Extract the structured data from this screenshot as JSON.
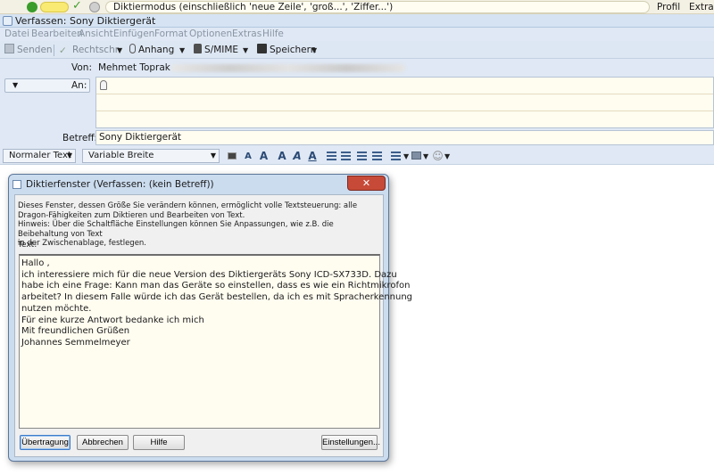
{
  "dragon_bar": {
    "status_text": "Diktiermodus (einschließlich 'neue Zeile', 'groß...', 'Ziffer...')",
    "profile_menu": "Profil",
    "extras_menu": "Extras",
    "icons": [
      "microphone-icon",
      "volume-meter-icon",
      "checkmark-icon",
      "stop-icon"
    ]
  },
  "window": {
    "title": "Verfassen: Sony Diktiergerät"
  },
  "menubar": {
    "items": [
      "Datei",
      "Bearbeiten",
      "Ansicht",
      "Einfügen",
      "Format",
      "Optionen",
      "Extras",
      "Hilfe"
    ]
  },
  "toolbar": {
    "send": "Senden",
    "spelling": "Rechtschr.",
    "attach": "Anhang",
    "smime": "S/MIME",
    "save": "Speichern"
  },
  "header": {
    "from_label": "Von:",
    "from_value": "Mehmet Toprak",
    "to_type": "",
    "to_label": "An:",
    "subject_label": "Betreff:",
    "subject_value": "Sony Diktiergerät"
  },
  "format_bar": {
    "paragraph_style": "Normaler Text",
    "font": "Variable Breite"
  },
  "dialog": {
    "title": "Diktierfenster (Verfassen: (kein Betreff))",
    "close": "✕",
    "description": [
      "Dieses Fenster, dessen Größe Sie verändern können, ermöglicht volle Textsteuerung: alle",
      "Dragon-Fähigkeiten zum Diktieren und Bearbeiten von Text.",
      "Hinweis: Über die Schaltfläche Einstellungen können Sie Anpassungen, wie z.B. die Beibehaltung von Text",
      "in der Zwischenablage, festlegen."
    ],
    "text_label": "Text:",
    "text_lines": [
      "Hallo ,",
      "ich interessiere mich für die neue Version des Diktiergeräts Sony ICD-SX733D. Dazu",
      "habe ich eine Frage: Kann man das Geräte so einstellen, dass es wie ein Richtmikrofon",
      "arbeitet? In diesem Falle würde ich das Gerät bestellen, da ich es mit Spracherkennung",
      "nutzen möchte.",
      "Für eine kurze Antwort bedanke ich mich",
      "Mit freundlichen Grüßen",
      "Johannes Semmelmeyer"
    ],
    "buttons": {
      "transfer": "Übertragung",
      "cancel": "Abbrechen",
      "help": "Hilfe",
      "settings": "Einstellungen..."
    }
  }
}
